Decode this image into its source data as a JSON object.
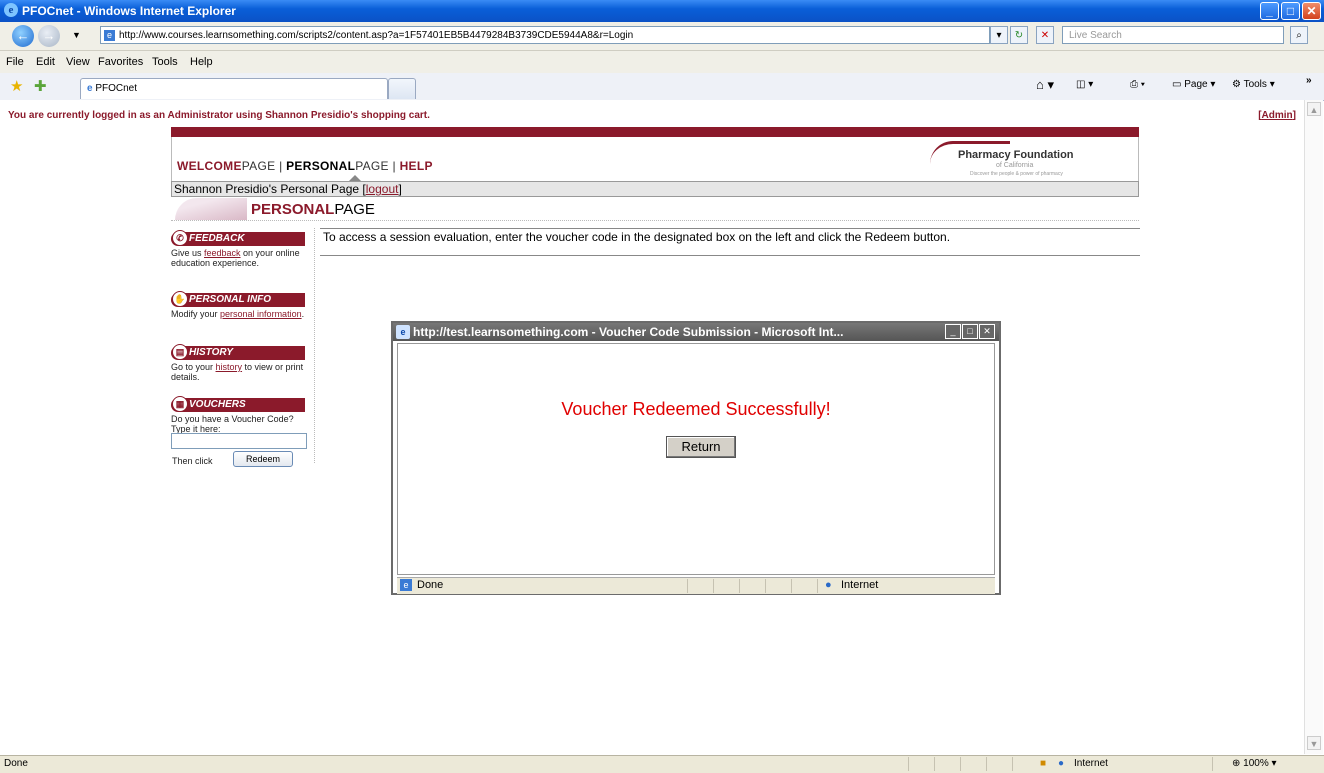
{
  "window": {
    "title": "PFOCnet - Windows Internet Explorer"
  },
  "address_bar": {
    "url": "http://www.courses.learnsomething.com/scripts2/content.asp?a=1F57401EB5B4479284B3739CDE5944A8&r=Login",
    "search_placeholder": "Live Search"
  },
  "menu": [
    "File",
    "Edit",
    "View",
    "Favorites",
    "Tools",
    "Help"
  ],
  "tabs": [
    {
      "label": "PFOCnet"
    }
  ],
  "toolbar": {
    "page_label": "Page",
    "tools_label": "Tools"
  },
  "admin_bar": {
    "message": "You are currently logged in as an Administrator using Shannon Presidio's shopping cart.",
    "admin_link": "Admin"
  },
  "site_nav": {
    "welcome_bold": "WELCOME",
    "welcome_light": "PAGE",
    "personal_bold": "PERSONAL",
    "personal_light": "PAGE",
    "help": "HELP",
    "separator": "|"
  },
  "logo": {
    "name": "Pharmacy Foundation",
    "sub": "of California",
    "tagline": "Discover the people & power of pharmacy"
  },
  "user_bar": {
    "text": "Shannon Presidio's Personal Page [",
    "logout": "logout",
    "close": "]"
  },
  "page_heading": {
    "bold": "PERSONAL",
    "light": "PAGE"
  },
  "sidebar": {
    "feedback": {
      "title": "FEEDBACK",
      "pre": "Give us ",
      "link": "feedback",
      "post": " on your online education experience."
    },
    "personal_info": {
      "title": "PERSONAL INFO",
      "pre": "Modify your ",
      "link": "personal information",
      "post": "."
    },
    "history": {
      "title": "HISTORY",
      "pre": "Go to your ",
      "link": "history",
      "post": " to view or print details."
    },
    "vouchers": {
      "title": "VOUCHERS",
      "text": "Do you have a Voucher Code? Type it here:",
      "then_click": "Then click",
      "redeem_label": "Redeem"
    }
  },
  "instructions": "To access a session evaluation, enter the voucher code in the designated box on the left and click the Redeem button.",
  "popup": {
    "title": "http://test.learnsomething.com - Voucher Code Submission - Microsoft Int...",
    "message": "Voucher Redeemed Successfully!",
    "return_label": "Return",
    "status_done": "Done",
    "status_zone": "Internet"
  },
  "status_bar": {
    "done": "Done",
    "zone": "Internet",
    "zoom": "100%"
  },
  "colors": {
    "brand": "#8b1a2b",
    "success_text": "#e00000",
    "titlebar": "#0a5fd8"
  }
}
